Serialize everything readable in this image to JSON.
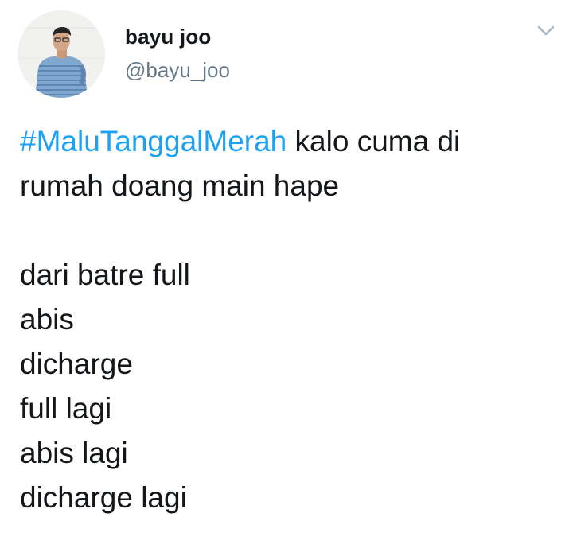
{
  "tweet": {
    "display_name": "bayu joo",
    "handle": "@bayu_joo",
    "caret_icon": "chevron-down-icon",
    "hashtag": "#MaluTanggalMerah",
    "line1_rest": " kalo cuma di",
    "line2": "rumah doang main hape",
    "lines": [
      "dari batre full",
      "abis",
      "dicharge",
      "full lagi",
      "abis lagi",
      "dicharge lagi"
    ]
  },
  "colors": {
    "hashtag": "#1da1f2",
    "text": "#14171a",
    "handle": "#657786",
    "caret": "#aab8c2"
  }
}
